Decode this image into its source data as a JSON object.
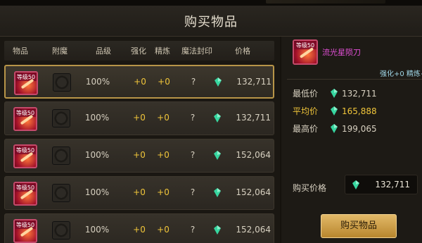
{
  "window": {
    "title": "购买物品"
  },
  "columns": [
    "物品",
    "附魔",
    "品级",
    "强化",
    "精炼",
    "魔法封印",
    "价格"
  ],
  "rows": [
    {
      "level": "等级50",
      "quality": "100%",
      "strengthen": "+0",
      "refine": "+0",
      "seal": "?",
      "price": "132,711",
      "selected": true
    },
    {
      "level": "等级50",
      "quality": "100%",
      "strengthen": "+0",
      "refine": "+0",
      "seal": "?",
      "price": "132,711",
      "selected": false
    },
    {
      "level": "等级50",
      "quality": "100%",
      "strengthen": "+0",
      "refine": "+0",
      "seal": "?",
      "price": "152,064",
      "selected": false
    },
    {
      "level": "等级50",
      "quality": "100%",
      "strengthen": "+0",
      "refine": "+0",
      "seal": "?",
      "price": "152,064",
      "selected": false
    },
    {
      "level": "等级50",
      "quality": "100%",
      "strengthen": "+0",
      "refine": "+0",
      "seal": "?",
      "price": "152,064",
      "selected": false
    }
  ],
  "detail": {
    "level": "等级50",
    "name": "流光星陨刀",
    "attrs": "强化+0 精炼+",
    "min_label": "最低价",
    "min_value": "132,711",
    "avg_label": "平均价",
    "avg_value": "165,888",
    "max_label": "最高价",
    "max_value": "199,065",
    "buy_price_label": "购买价格",
    "buy_price_value": "132,711",
    "buy_button": "购买物品"
  },
  "colors": {
    "accent_gold": "#f0c53a",
    "gem": "#37d6a0",
    "item_name": "#e24fd6",
    "selected_border": "#b89548"
  },
  "icons": {
    "currency": "gem-icon",
    "close": "close-icon"
  }
}
